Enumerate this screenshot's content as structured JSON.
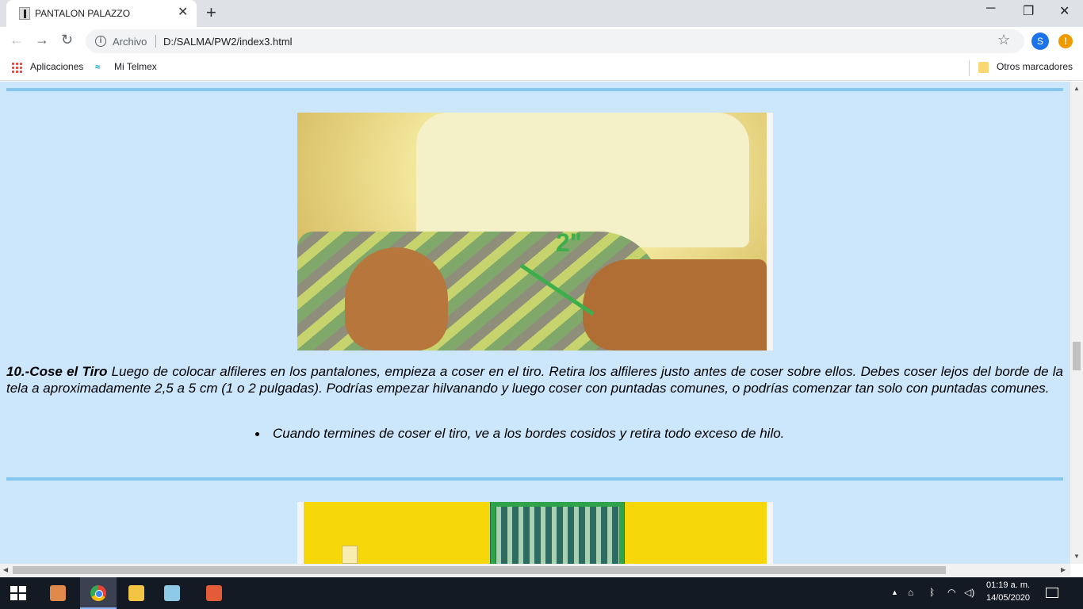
{
  "browser": {
    "tab_title": "PANTALON PALAZZO",
    "tab_close": "✕",
    "new_tab": "+",
    "window_controls": {
      "minimize": "─",
      "maximize": "❐",
      "close": "✕"
    },
    "nav": {
      "back": "←",
      "forward": "→",
      "reload": "↻"
    },
    "omnibox": {
      "scheme_label": "Archivo",
      "url": "D:/SALMA/PW2/index3.html",
      "info_icon": "i"
    },
    "star_icon": "☆",
    "profile_initial": "S",
    "alert_icon": "!",
    "bookmarks": {
      "apps": "Aplicaciones",
      "telmex": "Mi Telmex",
      "others": "Otros marcadores"
    }
  },
  "page": {
    "step_title": "10.-Cose el Tiro",
    "step_text": " Luego de colocar alfileres en los pantalones, empieza a coser en el tiro. Retira los alfileres justo antes de coser sobre ellos. Debes coser lejos del borde de la tela a aproximadamente 2,5 a 5 cm (1 o 2 pulgadas). Podrías empezar hilvanando y luego coser con puntadas comunes, o podrías comenzar tan solo con puntadas comunes.",
    "bullet": "Cuando termines de coser el tiro, ve a los bordes cosidos y retira todo exceso de hilo.",
    "photo1_mark": "2\"",
    "colors": {
      "background": "#cce6fc",
      "rule": "#86c7f2",
      "accent_green": "#3cae4b"
    }
  },
  "taskbar": {
    "time": "01:19 a. m.",
    "date": "14/05/2020",
    "apps": [
      "media-player-icon",
      "chrome-icon",
      "file-explorer-icon",
      "notepad-icon",
      "paint-icon"
    ]
  }
}
